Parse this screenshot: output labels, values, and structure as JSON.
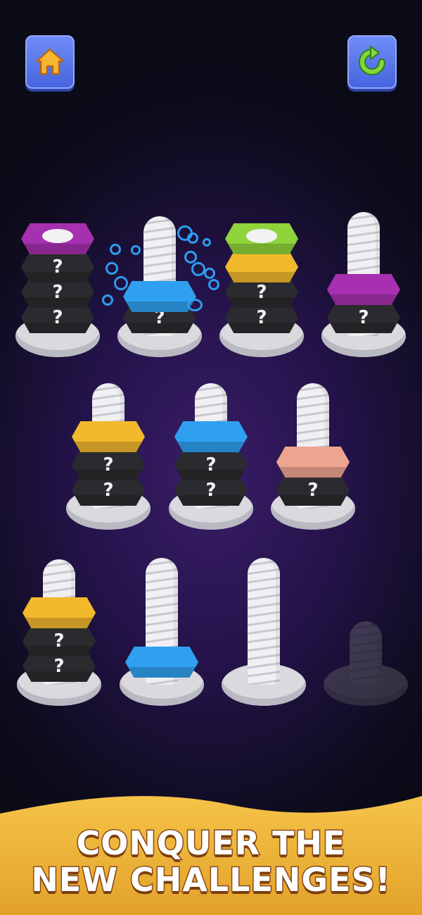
{
  "toolbar": {
    "home_icon": "home-icon",
    "restart_icon": "restart-icon"
  },
  "nut_hidden_symbol": "?",
  "colors": {
    "purple": "#a630b0",
    "blue": "#2fa0ef",
    "green": "#8fd43b",
    "yellow": "#f2b92c",
    "peach": "#eea58f",
    "black": "#2b2b2f"
  },
  "banner": {
    "line1": "CONQUER THE",
    "line2": "NEW CHALLENGES!"
  }
}
